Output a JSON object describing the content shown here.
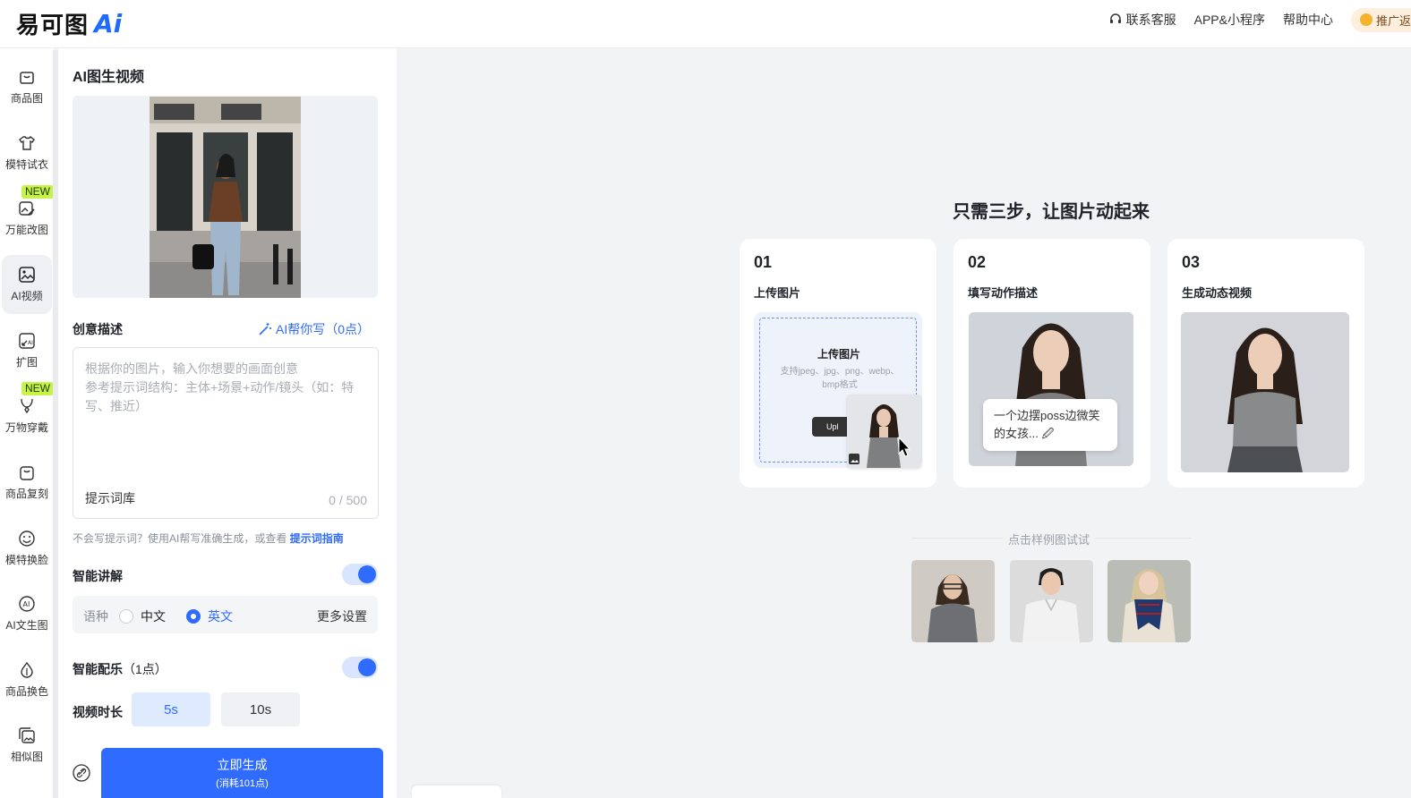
{
  "header": {
    "logo_text": "易可图",
    "logo_ai": "Ai",
    "nav": {
      "support": "联系客服",
      "app": "APP&小程序",
      "help": "帮助中心",
      "promo": "推广返"
    }
  },
  "sidebar": {
    "items": [
      {
        "label": "商品图"
      },
      {
        "label": "模特试衣"
      },
      {
        "label": "万能改图",
        "badge": "NEW"
      },
      {
        "label": "AI视频",
        "active": true
      },
      {
        "label": "扩图"
      },
      {
        "label": "万物穿戴",
        "badge": "NEW"
      },
      {
        "label": "商品复刻"
      },
      {
        "label": "模特换脸"
      },
      {
        "label": "AI文生图"
      },
      {
        "label": "商品换色"
      },
      {
        "label": "相似图"
      }
    ]
  },
  "panel": {
    "title": "AI图生视频",
    "desc_label": "创意描述",
    "ai_write": "AI帮你写（0点）",
    "placeholder_line1": "根据你的图片，输入你想要的画面创意",
    "placeholder_line2": "参考提示词结构：主体+场景+动作/镜头（如：特写、推近）",
    "prompt_library": "提示词库",
    "counter": "0 / 500",
    "hint_text": "不会写提示词？使用AI帮写准确生成，或查看",
    "hint_link": "提示词指南",
    "narration_label": "智能讲解",
    "lang_label": "语种",
    "lang_zh": "中文",
    "lang_en": "英文",
    "more_settings": "更多设置",
    "music_label": "智能配乐",
    "music_cost": "（1点）",
    "duration_label": "视频时长",
    "dur_5": "5s",
    "dur_10": "10s",
    "generate": "立即生成",
    "generate_cost": "(消耗101点)"
  },
  "main": {
    "title": "只需三步，让图片动起来",
    "steps": [
      {
        "num": "01",
        "label": "上传图片"
      },
      {
        "num": "02",
        "label": "填写动作描述"
      },
      {
        "num": "03",
        "label": "生成动态视频"
      }
    ],
    "upload_title": "上传图片",
    "upload_desc": "支持jpeg、jpg、png、webp、bmp格式",
    "upload_btn": "Upl",
    "bubble_text": "一个边摆poss边微笑的女孩... 🖉",
    "try_label": "点击样例图试试"
  },
  "colors": {
    "accent": "#2f6bff",
    "badge": "#c6f24a"
  }
}
